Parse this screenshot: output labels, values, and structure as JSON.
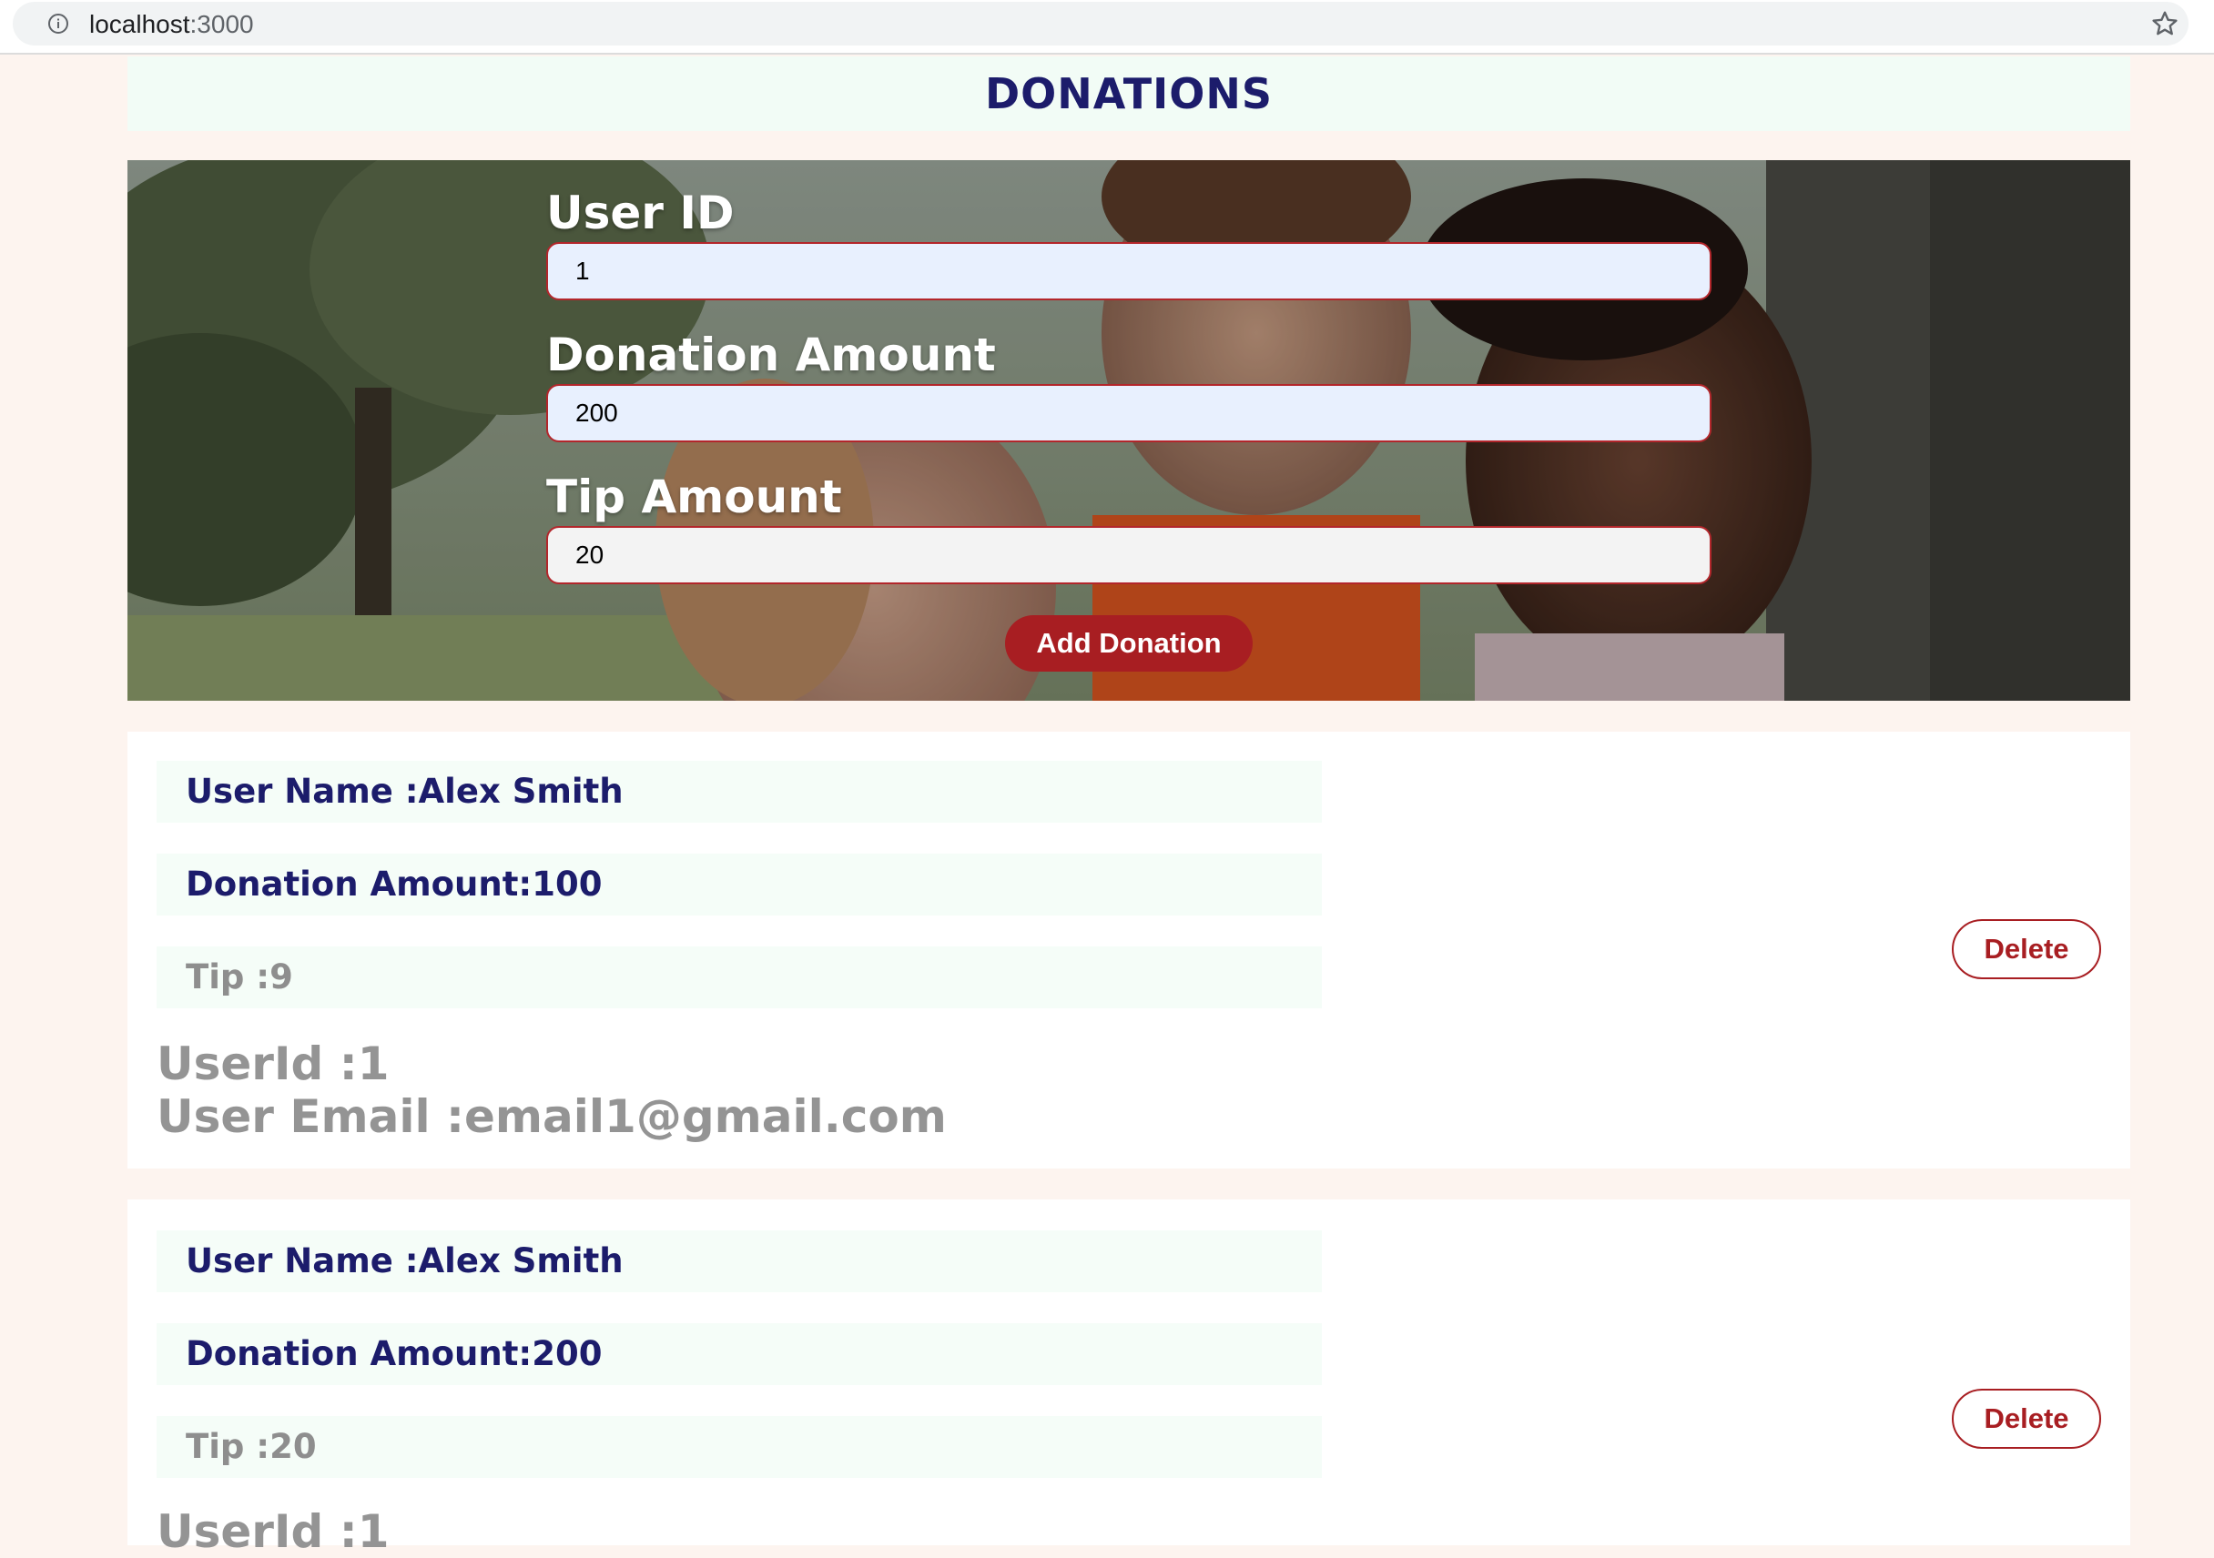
{
  "browser": {
    "host": "localhost",
    "port": ":3000"
  },
  "header": {
    "title": "DONATIONS"
  },
  "form": {
    "user_id_label": "User ID",
    "user_id_value": "1",
    "donation_label": "Donation Amount",
    "donation_value": "200",
    "tip_label": "Tip Amount",
    "tip_value": "20",
    "submit_label": "Add Donation"
  },
  "donations": [
    {
      "user_name": "User Name :Alex Smith",
      "donation_amount": "Donation Amount:100",
      "tip": "Tip :9",
      "user_id": "UserId :1",
      "user_email": "User Email :email1@gmail.com",
      "delete_label": "Delete"
    },
    {
      "user_name": "User Name :Alex Smith",
      "donation_amount": "Donation Amount:200",
      "tip": "Tip :20",
      "user_id": "UserId :1",
      "delete_label": "Delete"
    }
  ],
  "colors": {
    "page_bg": "#fdf4ef",
    "title": "#1c1c6b",
    "accent": "#a81e22",
    "row_bg": "#f5fdf8",
    "muted_text": "#8e8e8e"
  },
  "icons": [
    "info-icon",
    "star-icon"
  ]
}
